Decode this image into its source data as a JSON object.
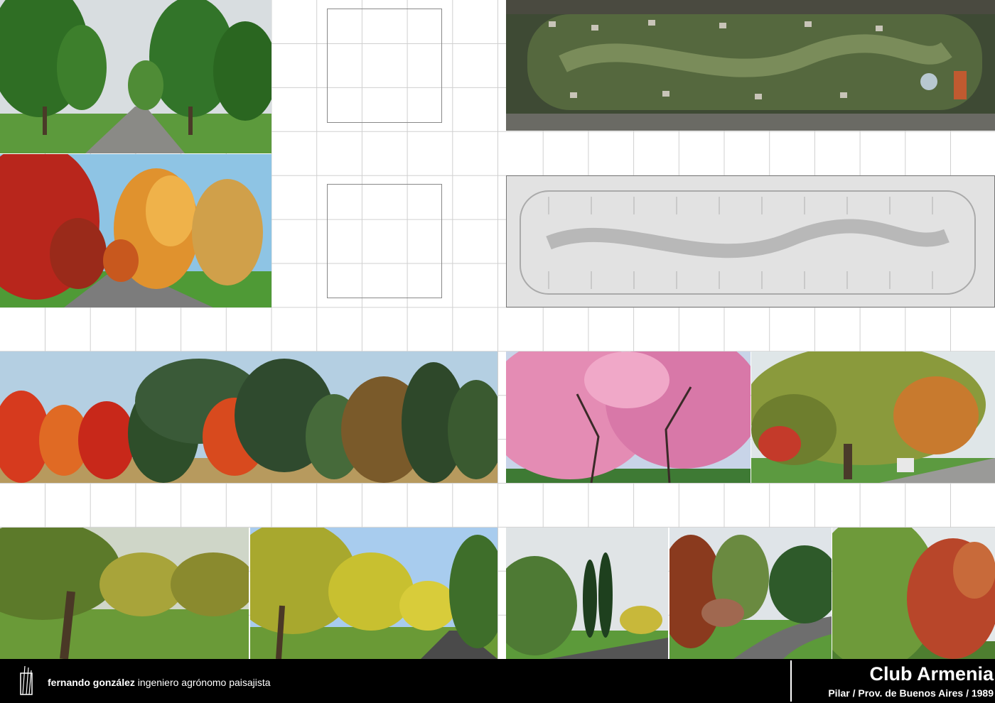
{
  "footer": {
    "author_name": "fernando gonzález",
    "author_title": "ingeniero agrónomo paisajista",
    "project_title": "Club Armenia",
    "project_subtitle": "Pilar / Prov. de Buenos Aires / 1989"
  },
  "photos": [
    {
      "name": "photo-tree-avenue-summer",
      "subject": "green tree avenue with road"
    },
    {
      "name": "photo-tree-avenue-autumn",
      "subject": "autumn-colored tree avenue"
    },
    {
      "name": "photo-aerial-site",
      "subject": "aerial view of the club"
    },
    {
      "name": "photo-site-plan",
      "subject": "gray relief site plan"
    },
    {
      "name": "photo-autumn-treeline",
      "subject": "panorama of autumn treeline"
    },
    {
      "name": "photo-pink-blossom",
      "subject": "pink flowering tree"
    },
    {
      "name": "photo-tree-bench",
      "subject": "large tree with bench"
    },
    {
      "name": "photo-park-lawn",
      "subject": "park lawn with trees"
    },
    {
      "name": "photo-yellow-trees-road",
      "subject": "yellow trees along road"
    },
    {
      "name": "photo-cypress-road",
      "subject": "cypress trees and road"
    },
    {
      "name": "photo-curved-road",
      "subject": "curved road with trees"
    },
    {
      "name": "photo-autumn-corner",
      "subject": "green and red trees"
    }
  ],
  "colors": {
    "grid_line": "#d0d0d0",
    "frame_line": "#888888",
    "footer_bg": "#000000",
    "footer_text": "#ffffff"
  }
}
